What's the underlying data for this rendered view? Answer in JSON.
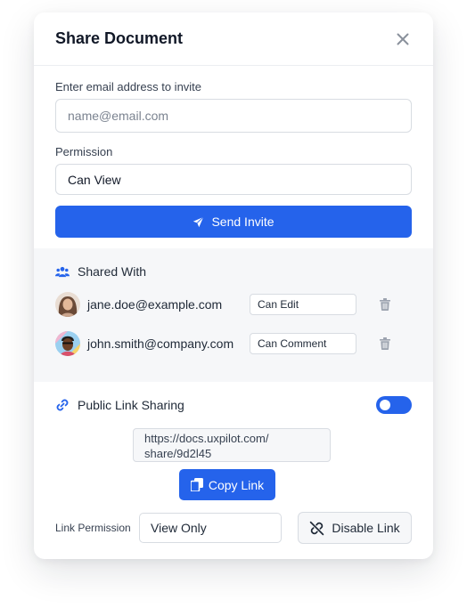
{
  "modal": {
    "title": "Share Document"
  },
  "invite": {
    "email_label": "Enter email address to invite",
    "email_placeholder": "name@email.com",
    "permission_label": "Permission",
    "permission_value": "Can View",
    "send_label": "Send Invite"
  },
  "shared": {
    "heading": "Shared With",
    "users": [
      {
        "email": "jane.doe@example.com",
        "permission": "Can Edit"
      },
      {
        "email": "john.smith@company.com",
        "permission": "Can Comment"
      }
    ]
  },
  "public": {
    "heading": "Public Link Sharing",
    "enabled": true,
    "link_line1": "https://docs.uxpilot.com/",
    "link_line2": "share/9d2l45",
    "copy_label": "Copy Link",
    "link_permission_label": "Link Permission",
    "link_permission_value": "View Only",
    "disable_label": "Disable Link"
  },
  "colors": {
    "accent": "#2563eb",
    "panel_bg": "#f6f7f9",
    "border": "#d8dce2"
  },
  "icons": {
    "close": "close-icon",
    "send": "send-icon",
    "users": "users-icon",
    "trash": "trash-icon",
    "link": "link-icon",
    "copy": "copy-icon",
    "unlink": "unlink-icon"
  }
}
